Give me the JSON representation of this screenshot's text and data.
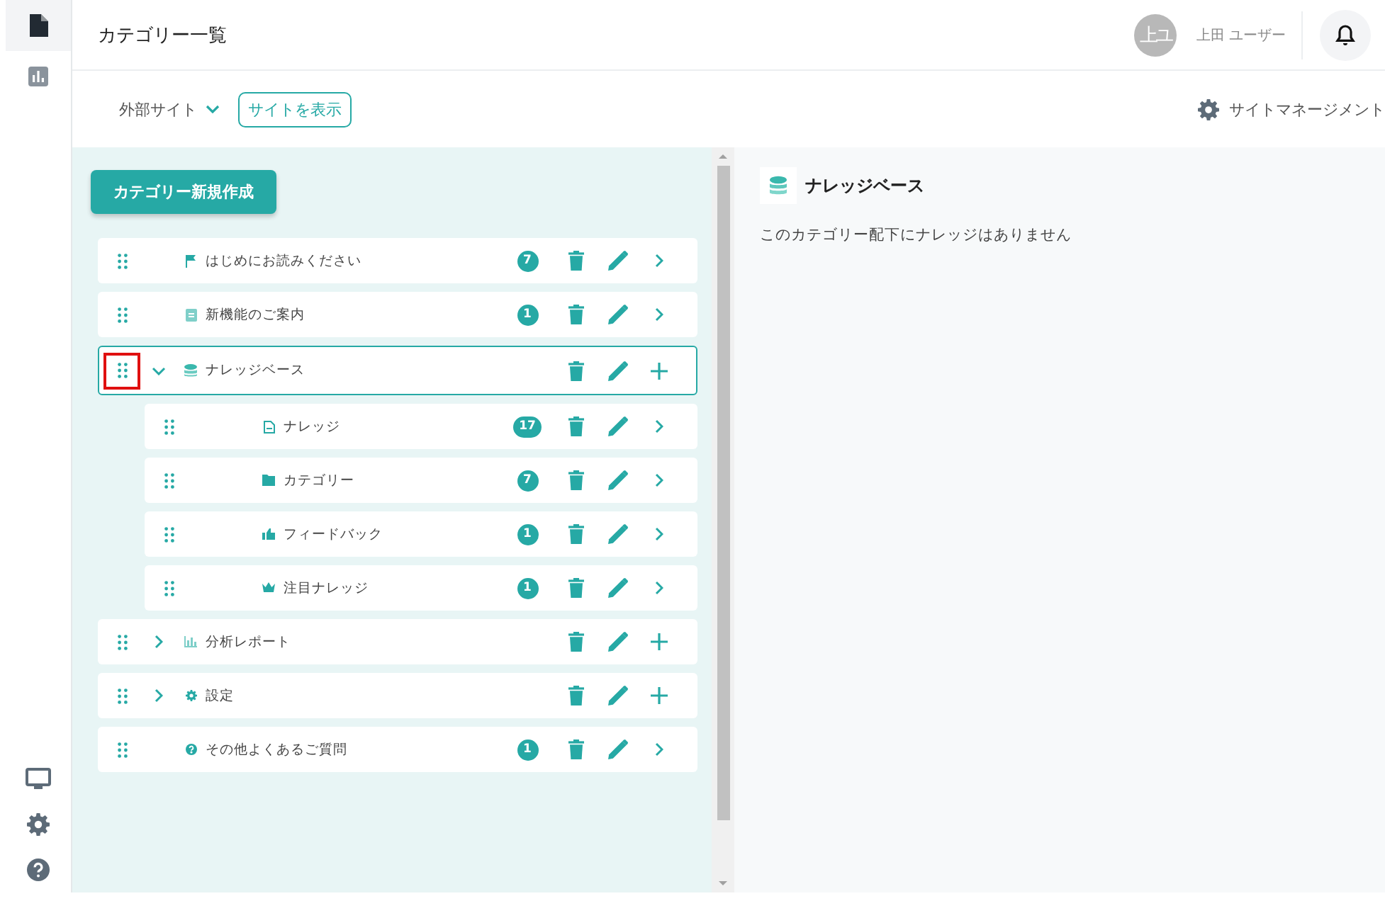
{
  "page_title": "カテゴリー一覧",
  "user": {
    "initials": "上ユ",
    "name": "上田 ユーザー"
  },
  "toolbar": {
    "site_selector": "外部サイト",
    "view_site_button": "サイトを表示",
    "management_link": "サイトマネージメント"
  },
  "create_button": "カテゴリー新規作成",
  "categories": [
    {
      "label": "はじめにお読みください",
      "kind": "flag",
      "count": "7",
      "selected": false,
      "marked": false
    },
    {
      "label": "新機能のご案内",
      "kind": "doc",
      "count": "1",
      "selected": false,
      "marked": false
    },
    {
      "label": "ナレッジベース",
      "kind": "stack",
      "selected": true,
      "marked": true,
      "expanded": true,
      "children": [
        {
          "label": "ナレッジ",
          "kind": "file",
          "count": "17",
          "selected": false,
          "marked": false
        },
        {
          "label": "カテゴリー",
          "kind": "folder",
          "count": "7",
          "selected": false,
          "marked": false
        },
        {
          "label": "フィードバック",
          "kind": "thumb",
          "count": "1",
          "selected": false,
          "marked": false
        },
        {
          "label": "注目ナレッジ",
          "kind": "crown",
          "count": "1",
          "selected": false,
          "marked": false
        }
      ]
    },
    {
      "label": "分析レポート",
      "kind": "chart",
      "selected": false,
      "marked": false,
      "expanded": false
    },
    {
      "label": "設定",
      "kind": "gear",
      "selected": false,
      "marked": false,
      "expanded": false
    },
    {
      "label": "その他よくあるご質問",
      "kind": "question",
      "count": "1",
      "selected": false,
      "marked": false
    }
  ],
  "detail": {
    "title": "ナレッジベース",
    "message": "このカテゴリー配下にナレッジはありません"
  }
}
